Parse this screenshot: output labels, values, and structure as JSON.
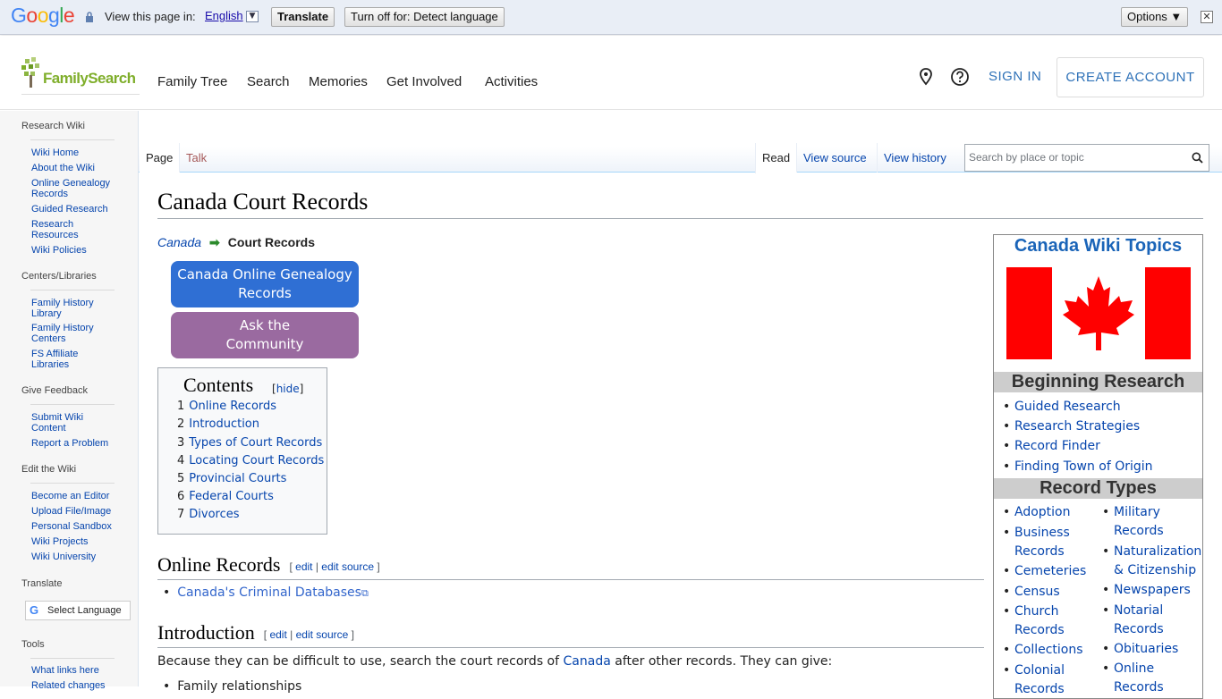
{
  "translate_bar": {
    "logo": "Google",
    "view_text": "View this page in:",
    "language": "English",
    "translate_button": "Translate",
    "turn_off_button": "Turn off for: Detect language",
    "options_button": "Options ▼",
    "close": "✕"
  },
  "header": {
    "logo_text": "FamilySearch",
    "nav": [
      "Family Tree",
      "Search",
      "Memories",
      "Get Involved",
      "Activities"
    ],
    "sign_in": "SIGN IN",
    "create_account": "CREATE ACCOUNT"
  },
  "sidebar": {
    "sections": [
      {
        "title": "Research Wiki",
        "items": [
          "Wiki Home",
          "About the Wiki",
          "Online Genealogy Records",
          "Guided Research",
          "Research Resources",
          "Wiki Policies"
        ]
      },
      {
        "title": "Centers/Libraries",
        "items": [
          "Family History Library",
          "Family History Centers",
          "FS Affiliate Libraries"
        ]
      },
      {
        "title": "Give Feedback",
        "items": [
          "Submit Wiki Content",
          "Report a Problem"
        ]
      },
      {
        "title": "Edit the Wiki",
        "items": [
          "Become an Editor",
          "Upload File/Image",
          "Personal Sandbox",
          "Wiki Projects",
          "Wiki University"
        ]
      },
      {
        "title": "Translate",
        "items": []
      },
      {
        "title": "Tools",
        "items": [
          "What links here",
          "Related changes"
        ]
      }
    ],
    "select_language": "Select Language"
  },
  "tabs": {
    "page": "Page",
    "talk": "Talk",
    "read": "Read",
    "view_source": "View source",
    "view_history": "View history",
    "search_placeholder": "Search by place or topic"
  },
  "content": {
    "title": "Canada Court Records",
    "breadcrumb_parent": "Canada",
    "breadcrumb_current": "Court Records",
    "button_online": "Canada Online Genealogy Records",
    "button_ask": "Ask the Community",
    "toc": {
      "heading": "Contents",
      "hide_label": "hide",
      "items": [
        {
          "num": "1",
          "label": "Online Records"
        },
        {
          "num": "2",
          "label": "Introduction"
        },
        {
          "num": "3",
          "label": "Types of Court Records"
        },
        {
          "num": "4",
          "label": "Locating Court Records"
        },
        {
          "num": "5",
          "label": "Provincial Courts"
        },
        {
          "num": "6",
          "label": "Federal Courts"
        },
        {
          "num": "7",
          "label": "Divorces"
        }
      ]
    },
    "sections": [
      {
        "heading": "Online Records",
        "edit": "edit",
        "edit_source": "edit source"
      },
      {
        "heading": "Introduction",
        "edit": "edit",
        "edit_source": "edit source"
      }
    ],
    "online_records_link": "Canada's Criminal Databases",
    "intro_text_before": "Because they can be difficult to use, search the court records of ",
    "intro_link": "Canada",
    "intro_text_after": " after other records. They can give:",
    "intro_bullet": "Family relationships"
  },
  "infobox": {
    "title": "Canada Wiki Topics",
    "beginning_heading": "Beginning Research",
    "beginning_items": [
      "Guided Research",
      "Research Strategies",
      "Record Finder",
      "Finding Town of Origin"
    ],
    "record_types_heading": "Record Types",
    "record_types_col1": [
      "Adoption",
      "Business Records",
      "Cemeteries",
      "Census",
      "Church Records",
      "Collections",
      "Colonial Records"
    ],
    "record_types_col2": [
      "Military Records",
      "Naturalization & Citizenship",
      "Newspapers",
      "Notarial Records",
      "Obituaries",
      "Online Records"
    ]
  },
  "colors": {
    "accent_blue": "#2f72b8",
    "button_blue": "#2f6fd4",
    "button_purple": "#9a6aa0",
    "link": "#0645ad"
  }
}
